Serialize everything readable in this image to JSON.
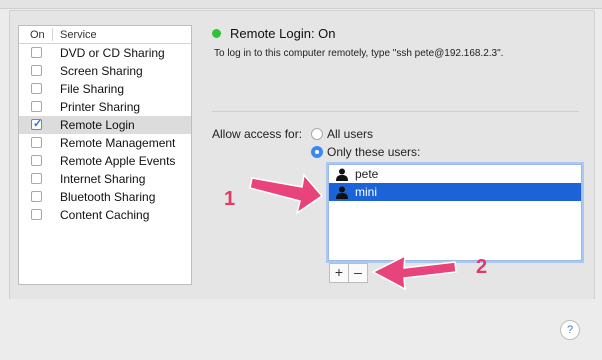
{
  "window": {
    "top_strip": ""
  },
  "service_list": {
    "header_on": "On",
    "header_service": "Service",
    "items": [
      {
        "label": "DVD or CD Sharing",
        "checked": false
      },
      {
        "label": "Screen Sharing",
        "checked": false
      },
      {
        "label": "File Sharing",
        "checked": false
      },
      {
        "label": "Printer Sharing",
        "checked": false
      },
      {
        "label": "Remote Login",
        "checked": true,
        "selected": true
      },
      {
        "label": "Remote Management",
        "checked": false
      },
      {
        "label": "Remote Apple Events",
        "checked": false
      },
      {
        "label": "Internet Sharing",
        "checked": false
      },
      {
        "label": "Bluetooth Sharing",
        "checked": false
      },
      {
        "label": "Content Caching",
        "checked": false
      }
    ]
  },
  "status": {
    "title": "Remote Login: On",
    "description": "To log in to this computer remotely, type \"ssh pete@192.168.2.3\".",
    "color": "#2fc23a"
  },
  "access": {
    "label": "Allow access for:",
    "options": [
      {
        "label": "All users",
        "selected": false
      },
      {
        "label": "Only these users:",
        "selected": true
      }
    ],
    "users": [
      {
        "name": "pete",
        "selected": false
      },
      {
        "name": "mini",
        "selected": true
      }
    ],
    "add_label": "+",
    "remove_label": "–"
  },
  "help_label": "?",
  "annotations": {
    "num1": "1",
    "num2": "2",
    "color": "#e03a66"
  }
}
